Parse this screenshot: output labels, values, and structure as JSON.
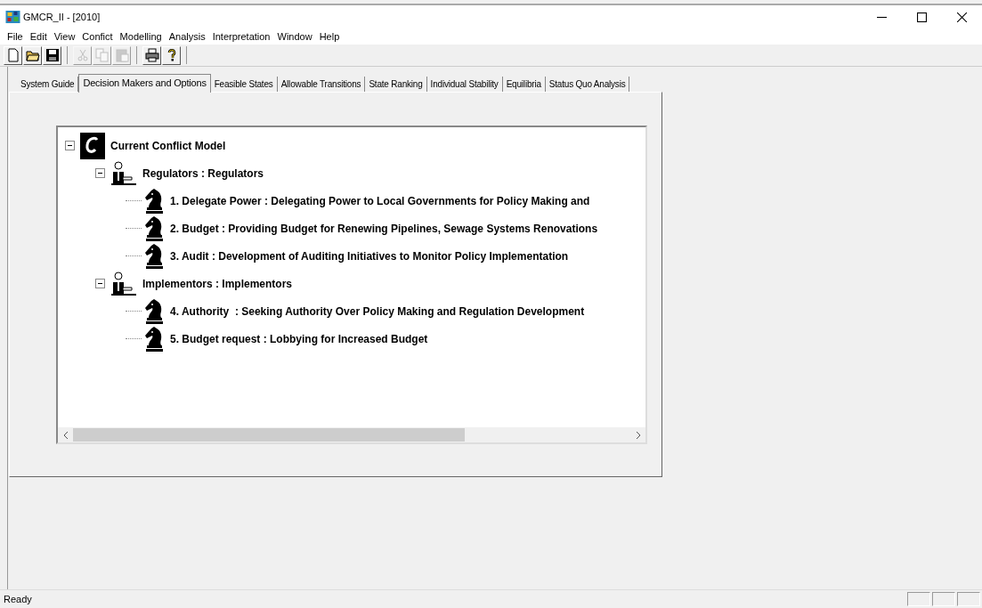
{
  "window": {
    "title": "GMCR_II - [2010]"
  },
  "menu": [
    "File",
    "Edit",
    "View",
    "Confict",
    "Modelling",
    "Analysis",
    "Interpretation",
    "Window",
    "Help"
  ],
  "toolbar": [
    {
      "kind": "new",
      "disabled": false
    },
    {
      "kind": "open",
      "disabled": false
    },
    {
      "kind": "save",
      "disabled": false
    },
    {
      "kind": "cut",
      "disabled": true
    },
    {
      "kind": "copy",
      "disabled": true
    },
    {
      "kind": "paste",
      "disabled": true
    },
    {
      "kind": "print",
      "disabled": false
    },
    {
      "kind": "help",
      "disabled": false
    }
  ],
  "tabs": [
    {
      "label": "System Guide",
      "selected": false
    },
    {
      "label": "Decision Makers and Options",
      "selected": true
    },
    {
      "label": "Feasible States",
      "selected": false
    },
    {
      "label": "Allowable Transitions",
      "selected": false
    },
    {
      "label": "State Ranking",
      "selected": false
    },
    {
      "label": "Individual Stability",
      "selected": false
    },
    {
      "label": "Equilibria",
      "selected": false
    },
    {
      "label": "Status Quo Analysis",
      "selected": false
    }
  ],
  "tree": {
    "kind": "model",
    "label": "Current Conflict Model",
    "expanded": true,
    "children": [
      {
        "kind": "decision_maker",
        "label": "Regulators : Regulators",
        "expanded": true,
        "children": [
          {
            "kind": "option",
            "label": "1. Delegate Power : Delegating Power to Local Governments for Policy Making and"
          },
          {
            "kind": "option",
            "label": "2. Budget : Providing Budget for Renewing Pipelines, Sewage Systems Renovations"
          },
          {
            "kind": "option",
            "label": "3. Audit : Development of Auditing Initiatives to Monitor Policy Implementation"
          }
        ]
      },
      {
        "kind": "decision_maker",
        "label": "Implementors : Implementors",
        "expanded": true,
        "children": [
          {
            "kind": "option",
            "label": "4. Authority  : Seeking Authority Over Policy Making and Regulation Development"
          },
          {
            "kind": "option",
            "label": "5. Budget request : Lobbying for Increased Budget"
          }
        ]
      }
    ]
  },
  "status_bar": {
    "text": "Ready"
  }
}
